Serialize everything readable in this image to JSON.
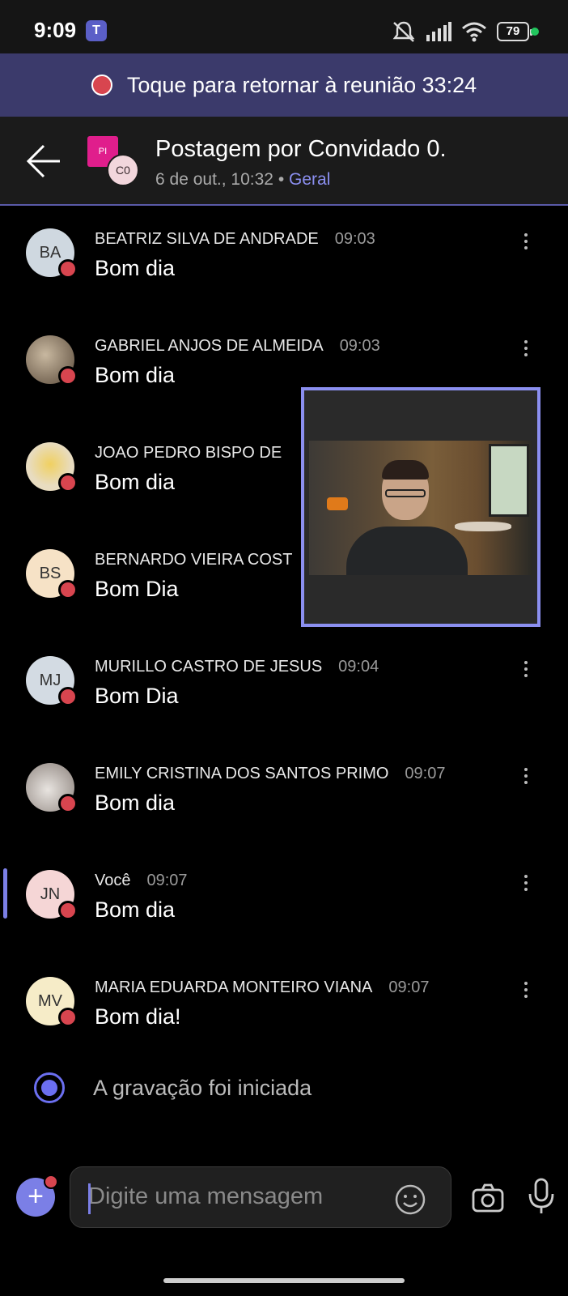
{
  "status_bar": {
    "time": "9:09",
    "app_icon": "teams-icon",
    "battery": "79"
  },
  "meeting_banner": {
    "text": "Toque para retornar à reunião 33:24"
  },
  "header": {
    "title": "Postagem por Convidado 0.",
    "date": "6 de out., 10:32",
    "separator": "•",
    "channel": "Geral",
    "avatar_pi": "PI",
    "avatar_co": "C0"
  },
  "messages": [
    {
      "initials": "BA",
      "name": "BEATRIZ SILVA DE ANDRADE",
      "time": "09:03",
      "text": "Bom dia",
      "avatar_bg": "#cfd8e0"
    },
    {
      "initials": "",
      "name": "GABRIEL ANJOS DE ALMEIDA",
      "time": "09:03",
      "text": "Bom dia",
      "avatar_bg": "#8a7a6a"
    },
    {
      "initials": "",
      "name": "JOAO PEDRO BISPO DE",
      "time": "",
      "text": "Bom dia",
      "avatar_bg": "#e8dcc0"
    },
    {
      "initials": "BS",
      "name": "BERNARDO VIEIRA COST",
      "time": "",
      "text": "Bom Dia",
      "avatar_bg": "#f6e2c6"
    },
    {
      "initials": "MJ",
      "name": "MURILLO CASTRO DE JESUS",
      "time": "09:04",
      "text": "Bom Dia",
      "avatar_bg": "#d3dbe3"
    },
    {
      "initials": "",
      "name": "EMILY CRISTINA DOS SANTOS PRIMO",
      "time": "09:07",
      "text": "Bom dia",
      "avatar_bg": "#b0a8a6"
    },
    {
      "initials": "JN",
      "name": "Você",
      "time": "09:07",
      "text": "Bom dia",
      "avatar_bg": "#f5d6d6"
    },
    {
      "initials": "MV",
      "name": "MARIA EDUARDA MONTEIRO VIANA",
      "time": "09:07",
      "text": "Bom dia!",
      "avatar_bg": "#f6ecc8"
    }
  ],
  "system_message": {
    "text": "A gravação foi iniciada"
  },
  "composer": {
    "placeholder": "Digite uma mensagem"
  },
  "colors": {
    "accent": "#7b7fe6",
    "presence_busy": "#d8454f",
    "banner_bg": "#3b3a6b"
  }
}
